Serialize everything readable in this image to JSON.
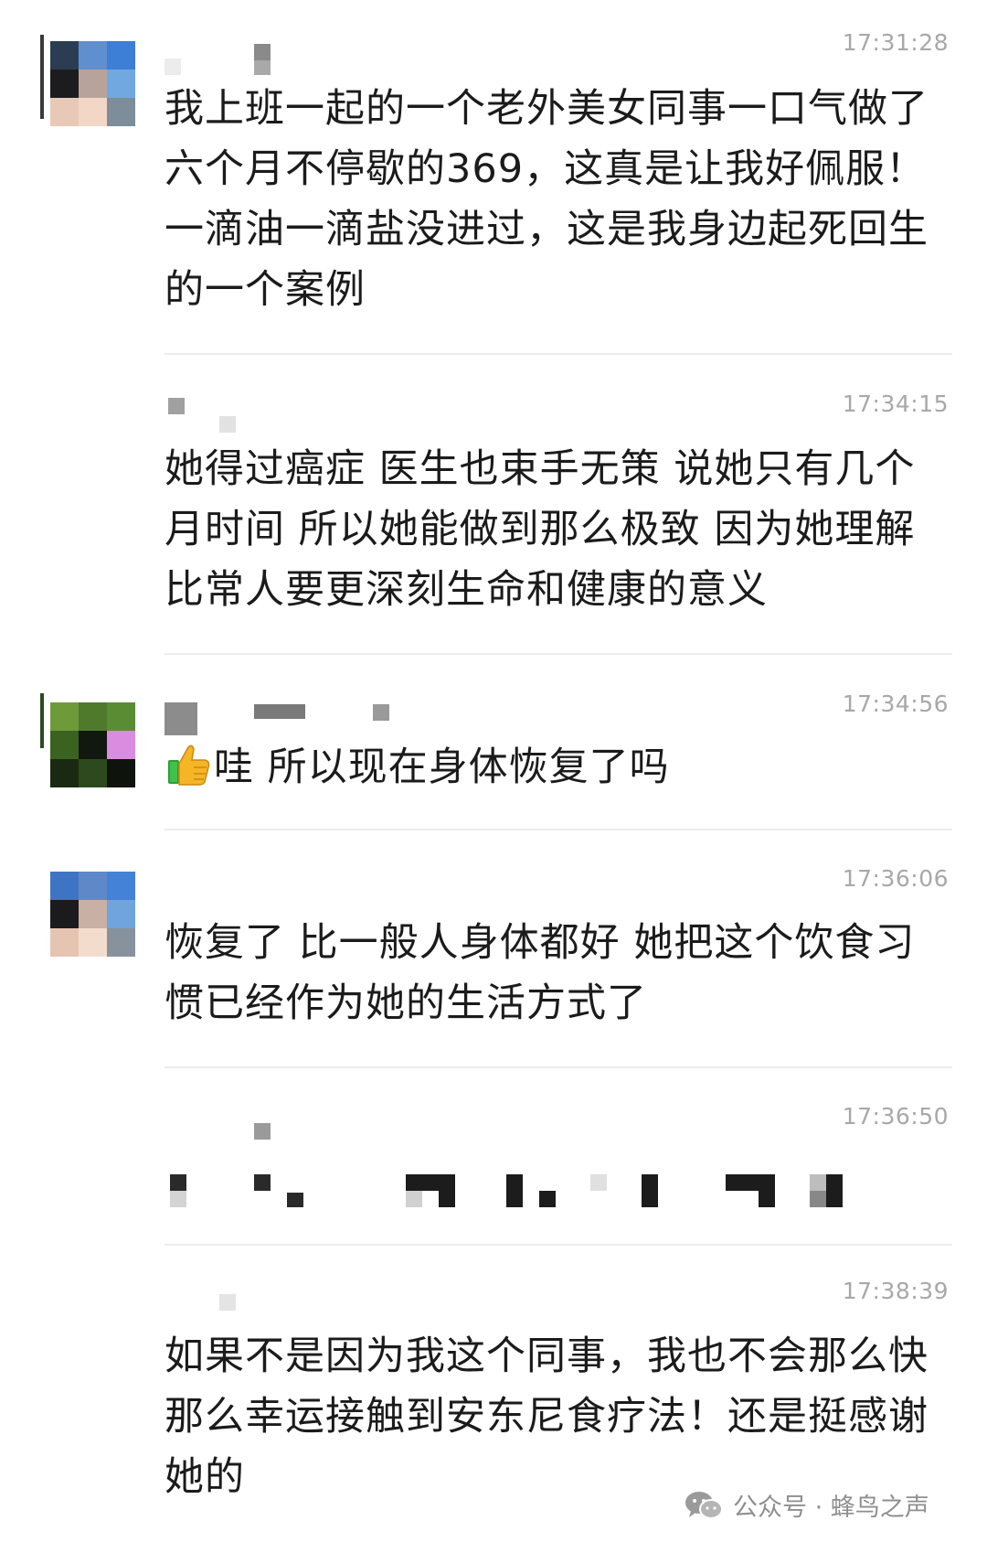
{
  "messages": [
    {
      "time": "17:31:28",
      "text": "我上班一起的一个老外美女同事一口气做了六个月不停歇的369，这真是让我好佩服！一滴油一滴盐没进过，这是我身边起死回生的一个案例"
    },
    {
      "time": "17:34:15",
      "text": "她得过癌症 医生也束手无策 说她只有几个月时间 所以她能做到那么极致 因为她理解比常人要更深刻生命和健康的意义"
    },
    {
      "time": "17:34:56",
      "text": "哇 所以现在身体恢复了吗",
      "icon": "thumbs-up-emoji"
    },
    {
      "time": "17:36:06",
      "text": "恢复了 比一般人身体都好 她把这个饮食习惯已经作为她的生活方式了"
    },
    {
      "time": "17:36:50",
      "text": ""
    },
    {
      "time": "17:38:39",
      "text": "如果不是因为我这个同事，我也不会那么快那么幸运接触到安东尼食疗法！还是挺感谢她的"
    }
  ],
  "watermark": {
    "text": "公众号 · 蜂鸟之声",
    "icon": "wechat-icon"
  },
  "colors": {
    "background": "#ffffff",
    "text": "#1b1b1b",
    "time": "#a8a8a8",
    "divider": "#ececec"
  }
}
